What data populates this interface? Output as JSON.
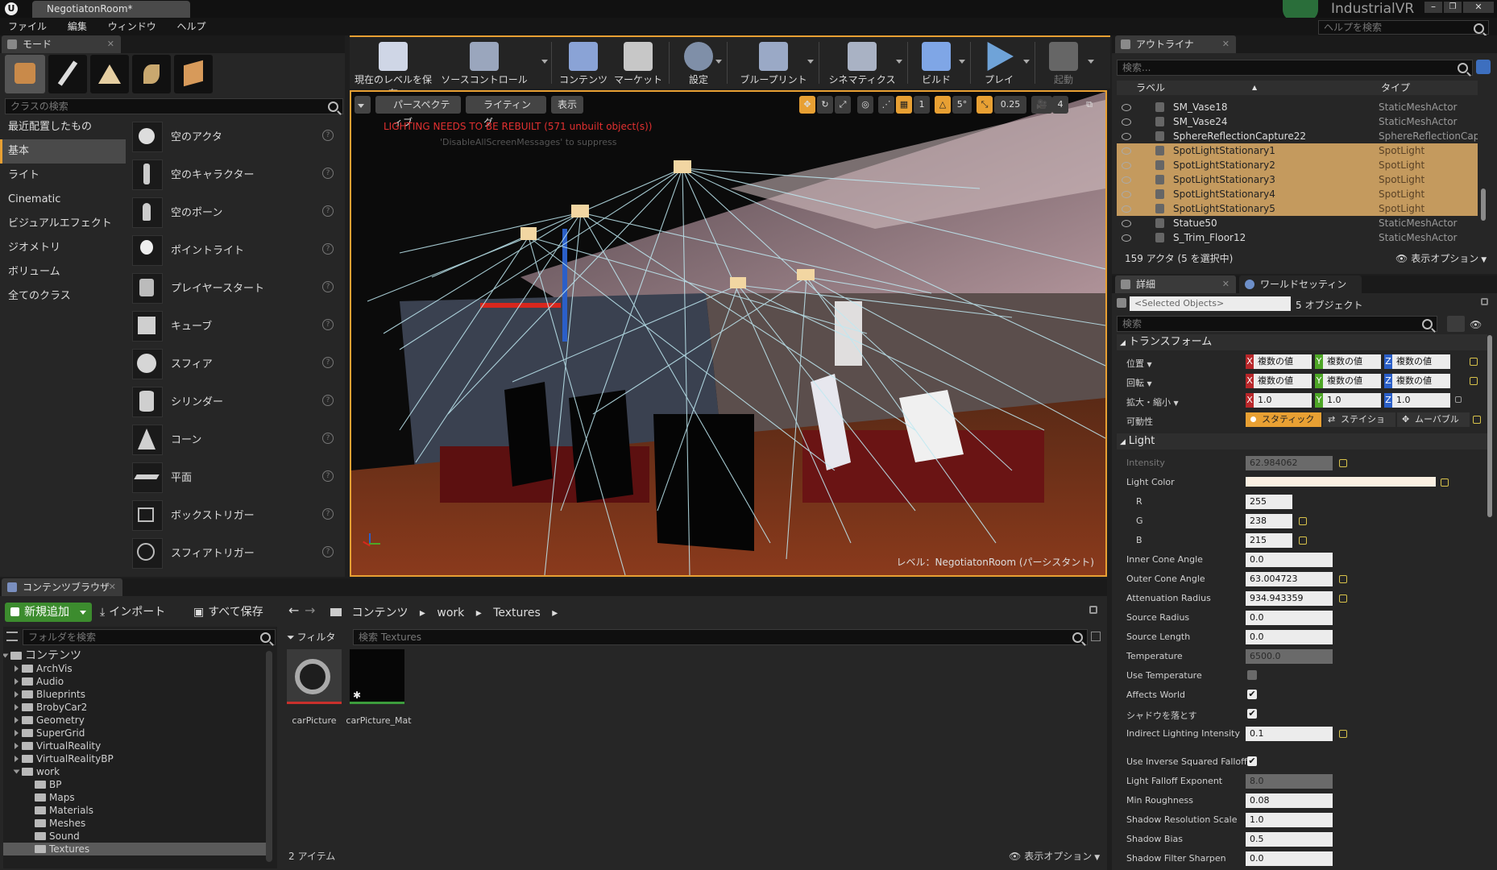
{
  "titlebar": {
    "tab_title": "NegotiatonRoom*",
    "brand": "IndustrialVR",
    "help_search_placeholder": "ヘルプを検索"
  },
  "menu": {
    "items": [
      "ファイル",
      "編集",
      "ウィンドウ",
      "ヘルプ"
    ]
  },
  "modes": {
    "tab": "モード",
    "search_placeholder": "クラスの検索",
    "categories": [
      "最近配置したもの",
      "基本",
      "ライト",
      "Cinematic",
      "ビジュアルエフェクト",
      "ジオメトリ",
      "ボリューム",
      "全てのクラス"
    ],
    "selected_category": "基本",
    "actors": [
      "空のアクタ",
      "空のキャラクター",
      "空のポーン",
      "ポイントライト",
      "プレイヤースタート",
      "キューブ",
      "スフィア",
      "シリンダー",
      "コーン",
      "平面",
      "ボックストリガー",
      "スフィアトリガー"
    ]
  },
  "toolbar": {
    "buttons": [
      {
        "label": "現在のレベルを保存",
        "icon": "save-icon",
        "color": "#cfd6e6"
      },
      {
        "label": "ソースコントロール",
        "icon": "source-control-icon",
        "color": "#9aa6bd"
      },
      {
        "label": "コンテンツ",
        "icon": "content-icon",
        "color": "#8aa3d6"
      },
      {
        "label": "マーケット",
        "icon": "marketplace-icon",
        "color": "#c7c7c7"
      },
      {
        "label": "設定",
        "icon": "settings-icon",
        "color": "#7f8fa8"
      },
      {
        "label": "ブループリント",
        "icon": "blueprint-icon",
        "color": "#9aa9c6"
      },
      {
        "label": "シネマティクス",
        "icon": "cinematics-icon",
        "color": "#a9b2c4"
      },
      {
        "label": "ビルド",
        "icon": "build-icon",
        "color": "#7fa6e6"
      },
      {
        "label": "プレイ",
        "icon": "play-icon",
        "color": "#6fa3d8"
      },
      {
        "label": "起動",
        "icon": "launch-icon",
        "color": "#666666"
      }
    ]
  },
  "viewport": {
    "perspective": "パースペクティブ",
    "lighting": "ライティング",
    "show": "表示",
    "warning": "LIGHTING NEEDS TO BE REBUILT (571 unbuilt object(s))",
    "warning_sub": "'DisableAllScreenMessages' to suppress",
    "grid_snap": "1",
    "rot_snap": "5°",
    "scale_snap": "0.25",
    "cam_speed": "4",
    "level_label": "レベル：NegotiatonRoom (パーシスタント)"
  },
  "content_browser": {
    "tab": "コンテンツブラウザ",
    "add_new": "新規追加",
    "import": "インポート",
    "save_all": "すべて保存",
    "breadcrumb": [
      "コンテンツ",
      "work",
      "Textures"
    ],
    "folder_search_placeholder": "フォルダを検索",
    "filter": "フィルタ",
    "asset_search_placeholder": "検索 Textures",
    "tree": [
      {
        "label": "コンテンツ",
        "level": 0,
        "open": true
      },
      {
        "label": "ArchVis",
        "level": 1
      },
      {
        "label": "Audio",
        "level": 1
      },
      {
        "label": "Blueprints",
        "level": 1
      },
      {
        "label": "BrobyCar2",
        "level": 1
      },
      {
        "label": "Geometry",
        "level": 1
      },
      {
        "label": "SuperGrid",
        "level": 1
      },
      {
        "label": "VirtualReality",
        "level": 1
      },
      {
        "label": "VirtualRealityBP",
        "level": 1
      },
      {
        "label": "work",
        "level": 1,
        "open": true
      },
      {
        "label": "BP",
        "level": 2
      },
      {
        "label": "Maps",
        "level": 2
      },
      {
        "label": "Materials",
        "level": 2
      },
      {
        "label": "Meshes",
        "level": 2
      },
      {
        "label": "Sound",
        "level": 2
      },
      {
        "label": "Textures",
        "level": 2,
        "selected": true
      }
    ],
    "assets": [
      "carPicture",
      "carPicture_Mat"
    ],
    "item_count": "2 アイテム",
    "view_options": "表示オプション"
  },
  "outliner": {
    "tab": "アウトライナ",
    "search_placeholder": "検索...",
    "col_label": "ラベル",
    "col_type": "タイプ",
    "rows": [
      {
        "name": "SM_Vase18",
        "type": "StaticMeshActor",
        "selected": false
      },
      {
        "name": "SM_Vase24",
        "type": "StaticMeshActor",
        "selected": false
      },
      {
        "name": "SphereReflectionCapture22",
        "type": "SphereReflectionCaptu",
        "selected": false
      },
      {
        "name": "SpotLightStationary1",
        "type": "SpotLight",
        "selected": true
      },
      {
        "name": "SpotLightStationary2",
        "type": "SpotLight",
        "selected": true
      },
      {
        "name": "SpotLightStationary3",
        "type": "SpotLight",
        "selected": true
      },
      {
        "name": "SpotLightStationary4",
        "type": "SpotLight",
        "selected": true
      },
      {
        "name": "SpotLightStationary5",
        "type": "SpotLight",
        "selected": true
      },
      {
        "name": "Statue50",
        "type": "StaticMeshActor",
        "selected": false
      },
      {
        "name": "S_Trim_Floor12",
        "type": "StaticMeshActor",
        "selected": false
      }
    ],
    "status": "159 アクタ (5 を選択中)",
    "view_options": "表示オプション"
  },
  "details": {
    "tab": "詳細",
    "tab2": "ワールドセッティン",
    "selected_objects": "<Selected Objects>",
    "object_count": "5 オブジェクト",
    "search_placeholder": "検索",
    "transform_header": "トランスフォーム",
    "location_label": "位置",
    "rotation_label": "回転",
    "scale_label": "拡大・縮小",
    "mobility_label": "可動性",
    "multi_value": "複数の値",
    "scale_x": "1.0",
    "scale_y": "1.0",
    "scale_z": "1.0",
    "mobility": [
      "スタティック",
      "ステイショ",
      "ムーバブル"
    ],
    "light_header": "Light",
    "props": [
      {
        "label": "Intensity",
        "value": "62.984062",
        "kind": "disabled"
      },
      {
        "label": "Light Color",
        "value": "",
        "kind": "color"
      },
      {
        "label": "R",
        "value": "255",
        "kind": "small"
      },
      {
        "label": "G",
        "value": "238",
        "kind": "small"
      },
      {
        "label": "B",
        "value": "215",
        "kind": "small"
      },
      {
        "label": "Inner Cone Angle",
        "value": "0.0",
        "kind": "field"
      },
      {
        "label": "Outer Cone Angle",
        "value": "63.004723",
        "kind": "field"
      },
      {
        "label": "Attenuation Radius",
        "value": "934.943359",
        "kind": "field"
      },
      {
        "label": "Source Radius",
        "value": "0.0",
        "kind": "field"
      },
      {
        "label": "Source Length",
        "value": "0.0",
        "kind": "field"
      },
      {
        "label": "Temperature",
        "value": "6500.0",
        "kind": "disabled"
      },
      {
        "label": "Use Temperature",
        "value": "",
        "kind": "check-off"
      },
      {
        "label": "Affects World",
        "value": "✔",
        "kind": "check"
      },
      {
        "label": "シャドウを落とす",
        "value": "✔",
        "kind": "check"
      },
      {
        "label": "Indirect Lighting Intensity",
        "value": "0.1",
        "kind": "field"
      },
      {
        "label": "Use Inverse Squared Falloff",
        "value": "✔",
        "kind": "check"
      },
      {
        "label": "Light Falloff Exponent",
        "value": "8.0",
        "kind": "disabled"
      },
      {
        "label": "Min Roughness",
        "value": "0.08",
        "kind": "field"
      },
      {
        "label": "Shadow Resolution Scale",
        "value": "1.0",
        "kind": "field"
      },
      {
        "label": "Shadow Bias",
        "value": "0.5",
        "kind": "field"
      },
      {
        "label": "Shadow Filter Sharpen",
        "value": "0.0",
        "kind": "field"
      }
    ]
  },
  "colors": {
    "accent": "#e8a033",
    "selection": "#c49a5e",
    "add_new": "#3c8c2e"
  }
}
